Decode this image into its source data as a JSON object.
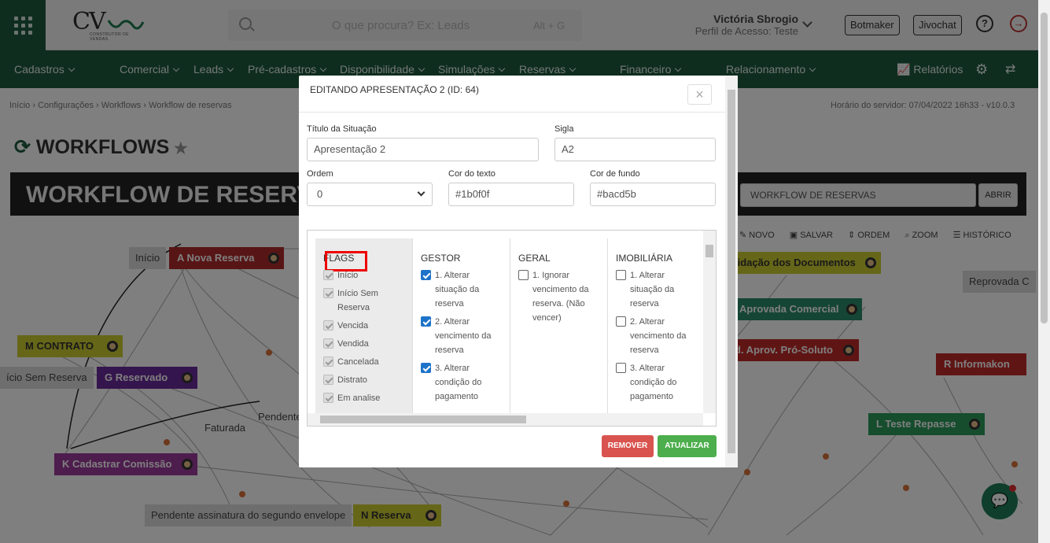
{
  "header": {
    "logo_text": "CV",
    "logo_tagline": "CONSTRUTOR DE VENDAS",
    "search_placeholder": "O que procura? Ex: Leads",
    "search_shortcut": "Alt + G",
    "user_name": "Victória Sbrogio",
    "user_profile": "Perfil de Acesso: Teste",
    "btn_botmaker": "Botmaker",
    "btn_jivochat": "Jivochat"
  },
  "nav": {
    "items": [
      "Cadastros",
      "Comercial",
      "Leads",
      "Pré-cadastros",
      "Disponibilidade",
      "Simulações",
      "Reservas",
      "Financeiro",
      "Relacionamento"
    ],
    "reports": "Relatórios"
  },
  "breadcrumb": "Início  ›  Configurações  ›  Workflows  ›  Workflow de reservas",
  "server_time": "Horário do servidor: 07/04/2022 16h33 - v10.0.3",
  "page_title": "WORKFLOWS",
  "workflow": {
    "title": "WORKFLOW DE RESERVAS",
    "select_value": "WORKFLOW DE RESERVAS",
    "open_button": "ABRIR",
    "tools": [
      "NOVO",
      "SALVAR",
      "ORDEM",
      "ZOOM",
      "HISTÓRICO"
    ]
  },
  "nodes": [
    {
      "code": "A",
      "name": "Nova Reserva",
      "color": "#b02a2a"
    },
    {
      "code": "M",
      "name": "CONTRATO",
      "color": "#cccc33"
    },
    {
      "code": "G",
      "name": "Reservado",
      "color": "#6a2a9a"
    },
    {
      "code": "K",
      "name": "Cadastrar Comissão",
      "color": "#9a3a9a"
    },
    {
      "code": "N",
      "name": "Reserva",
      "color": "#cccc33"
    },
    {
      "code": "R",
      "name": "Informakon",
      "color": "#c02a2a"
    },
    {
      "code": "L",
      "name": "Teste Repasse",
      "color": "#2a9a5a"
    },
    {
      "code": "",
      "name": "lidação dos Documentos",
      "color": "#cccc33"
    },
    {
      "code": "",
      "name": "Aprovada Comercial",
      "color": "#2a8a6a"
    },
    {
      "code": "",
      "name": "d. Aprov. Pró-Soluto",
      "color": "#c02a2a"
    }
  ],
  "labels": [
    "Início",
    "ício Sem Reserva",
    "Faturada",
    "Pendente",
    "Pendente assinatura do segundo envelope",
    "Reprovada C"
  ],
  "modal": {
    "title": "EDITANDO APRESENTAÇÃO 2 (ID: 64)",
    "close": "×",
    "fields": {
      "titulo_label": "Título da Situação",
      "titulo_value": "Apresentação 2",
      "sigla_label": "Sigla",
      "sigla_value": "A2",
      "ordem_label": "Ordem",
      "ordem_value": "0",
      "cor_texto_label": "Cor do texto",
      "cor_texto_value": "#1b0f0f",
      "cor_fundo_label": "Cor de fundo",
      "cor_fundo_value": "#bacd5b"
    },
    "columns": {
      "flags": {
        "header": "FLAGS",
        "items": [
          "Início",
          "Início Sem Reserva",
          "Vencida",
          "Vendida",
          "Cancelada",
          "Distrato",
          "Em analise"
        ]
      },
      "gestor": {
        "header": "GESTOR",
        "items": [
          "1. Alterar situação da reserva",
          "2. Alterar vencimento da reserva",
          "3. Alterar condição do pagamento"
        ]
      },
      "geral": {
        "header": "GERAL",
        "items": [
          "1. Ignorar vencimento da reserva. (Não vencer)"
        ]
      },
      "imobiliaria": {
        "header": "IMOBILIÁRIA",
        "items": [
          "1. Alterar situação da reserva",
          "2. Alterar vencimento da reserva",
          "3. Alterar condição do pagamento"
        ]
      }
    },
    "btn_remove": "REMOVER",
    "btn_update": "ATUALIZAR"
  }
}
